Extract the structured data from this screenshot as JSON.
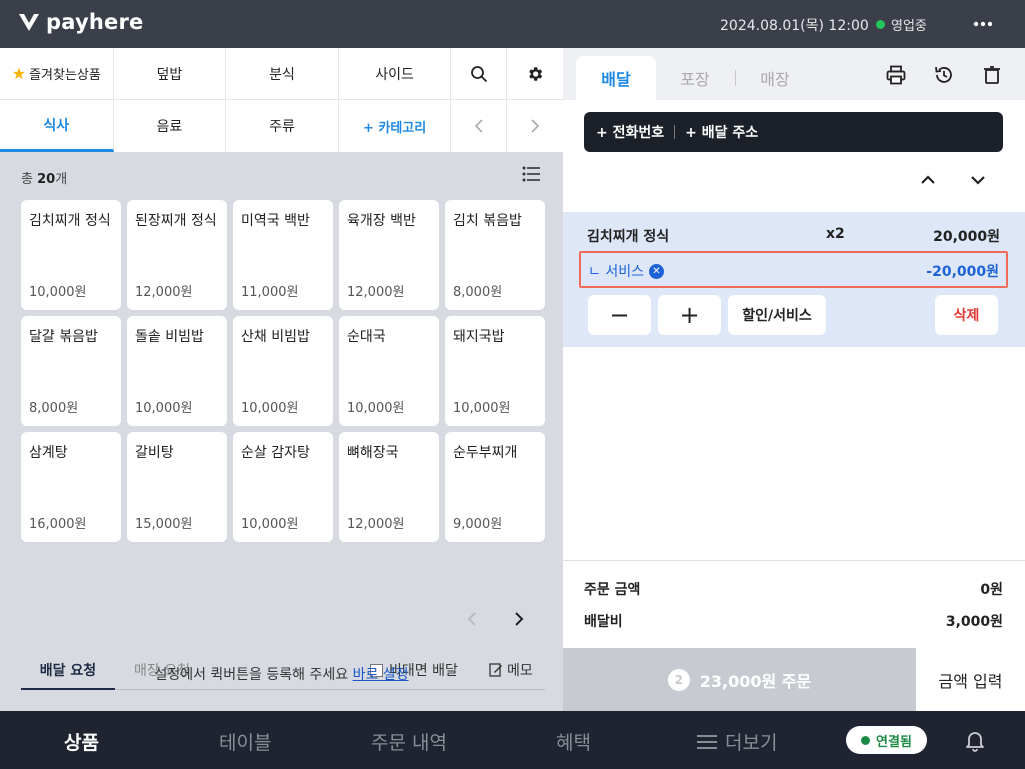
{
  "brand": {
    "name": "payhere"
  },
  "topbar": {
    "datetime": "2024.08.01(목) 12:00",
    "status": "영업중"
  },
  "categories": {
    "row1": {
      "favorites": "즐겨찾는상품",
      "c1": "덮밥",
      "c2": "분식",
      "c3": "사이드"
    },
    "row2": {
      "c1": "식사",
      "c2": "음료",
      "c3": "주류",
      "add": "+ 카테고리"
    }
  },
  "products": {
    "count_prefix": "총",
    "count": "20",
    "count_suffix": "개",
    "items": [
      {
        "name": "김치찌개 정식",
        "price": "10,000원"
      },
      {
        "name": "된장찌개 정식",
        "price": "12,000원"
      },
      {
        "name": "미역국 백반",
        "price": "11,000원"
      },
      {
        "name": "육개장 백반",
        "price": "12,000원"
      },
      {
        "name": "김치 볶음밥",
        "price": "8,000원"
      },
      {
        "name": "달걀 볶음밥",
        "price": "8,000원"
      },
      {
        "name": "돌솥 비빔밥",
        "price": "10,000원"
      },
      {
        "name": "산채 비빔밥",
        "price": "10,000원"
      },
      {
        "name": "순대국",
        "price": "10,000원"
      },
      {
        "name": "돼지국밥",
        "price": "10,000원"
      },
      {
        "name": "삼계탕",
        "price": "16,000원"
      },
      {
        "name": "갈비탕",
        "price": "15,000원"
      },
      {
        "name": "순살 감자탕",
        "price": "10,000원"
      },
      {
        "name": "뼈해장국",
        "price": "12,000원"
      },
      {
        "name": "순두부찌개",
        "price": "9,000원"
      }
    ]
  },
  "requests": {
    "tab_delivery": "배달 요청",
    "tab_store": "매장 요청",
    "no_contact": "비대면 배달",
    "memo": "메모",
    "hint_text": "설정에서 퀵버튼을 등록해 주세요",
    "hint_link": "바로 설정"
  },
  "order": {
    "tabs": {
      "delivery": "배달",
      "takeout": "포장",
      "store": "매장"
    },
    "phone_button": "+ 전화번호",
    "address_button": "+ 배달 주소",
    "item": {
      "name": "김치찌개 정식",
      "qty": "x2",
      "price": "20,000원"
    },
    "service": {
      "label": "ㄴ 서비스",
      "price": "-20,000원"
    },
    "buttons": {
      "minus": "−",
      "plus": "+",
      "discount": "할인/서비스",
      "delete": "삭제"
    },
    "summary": {
      "order_amount_label": "주문 금액",
      "order_amount": "0원",
      "delivery_fee_label": "배달비",
      "delivery_fee": "3,000원"
    },
    "submit": {
      "badge": "2",
      "label": "23,000원 주문"
    },
    "amount_input": "금액 입력"
  },
  "bottom_nav": {
    "products": "상품",
    "tables": "테이블",
    "history": "주문 내역",
    "benefits": "혜택",
    "more": "더보기",
    "connected": "연결됨"
  },
  "colors": {
    "accent": "#1e88e5",
    "service": "#1e63d6",
    "highlight_border": "#ef6c5a",
    "danger": "#e53935"
  }
}
